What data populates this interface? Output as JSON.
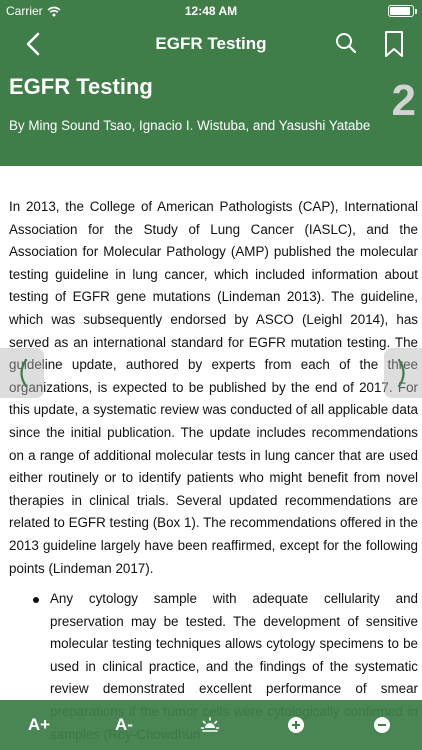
{
  "status": {
    "carrier": "Carrier",
    "time": "12:48 AM",
    "battery_level": 0.9
  },
  "nav": {
    "title": "EGFR Testing",
    "back_icon": "chevron-left-icon",
    "search_icon": "search-icon",
    "bookmark_icon": "bookmark-icon"
  },
  "header": {
    "title": "EGFR Testing",
    "authors": "By Ming Sound Tsao, Ignacio I. Wistuba, and Yasushi Yatabe",
    "chapter": "2"
  },
  "body": {
    "paragraph": "In 2013, the College of American Pathologists (CAP), International Association for the Study of Lung Cancer (IASLC), and the Association for Molecular Pathology (AMP) published the molecular testing guideline in lung cancer, which included information about testing of EGFR gene mutations (Lindeman 2013). The guideline, which was subsequently endorsed by ASCO (Leighl 2014), has served as an international standard for EGFR mutation testing. The guideline update, authored by experts from each of the three organizations, is expected to be published by the end of 2017. For this update, a systematic review was conducted of all applicable data since the initial publication. The update includes recommendations on a range of additional molecular tests in lung cancer that are used either routinely or to identify patients who might benefit from novel therapies in clinical trials. Several updated recommendations are related to EGFR testing (Box 1). The recommendations offered in the 2013 guideline largely have been reaffirmed, except for the following points (Lindeman 2017).",
    "bullets": [
      "Any cytology sample with adequate cellularity and preservation may be tested. The development of sensitive molecular testing techniques allows cytology specimens to be used in clinical practice, and the findings of the systematic review demonstrated excellent performance of smear preparations if the tumor cells were cytologically confirmed in samples (Roy-Chowdhuri"
    ]
  },
  "toolbar": {
    "font_increase": "A+",
    "font_decrease": "A-",
    "brightness_icon": "brightness-icon",
    "zoom_in_icon": "zoom-in-icon",
    "zoom_out_icon": "zoom-out-icon"
  },
  "colors": {
    "header_green": "#3f7d49",
    "chapter_gray": "#d3d3d3"
  }
}
